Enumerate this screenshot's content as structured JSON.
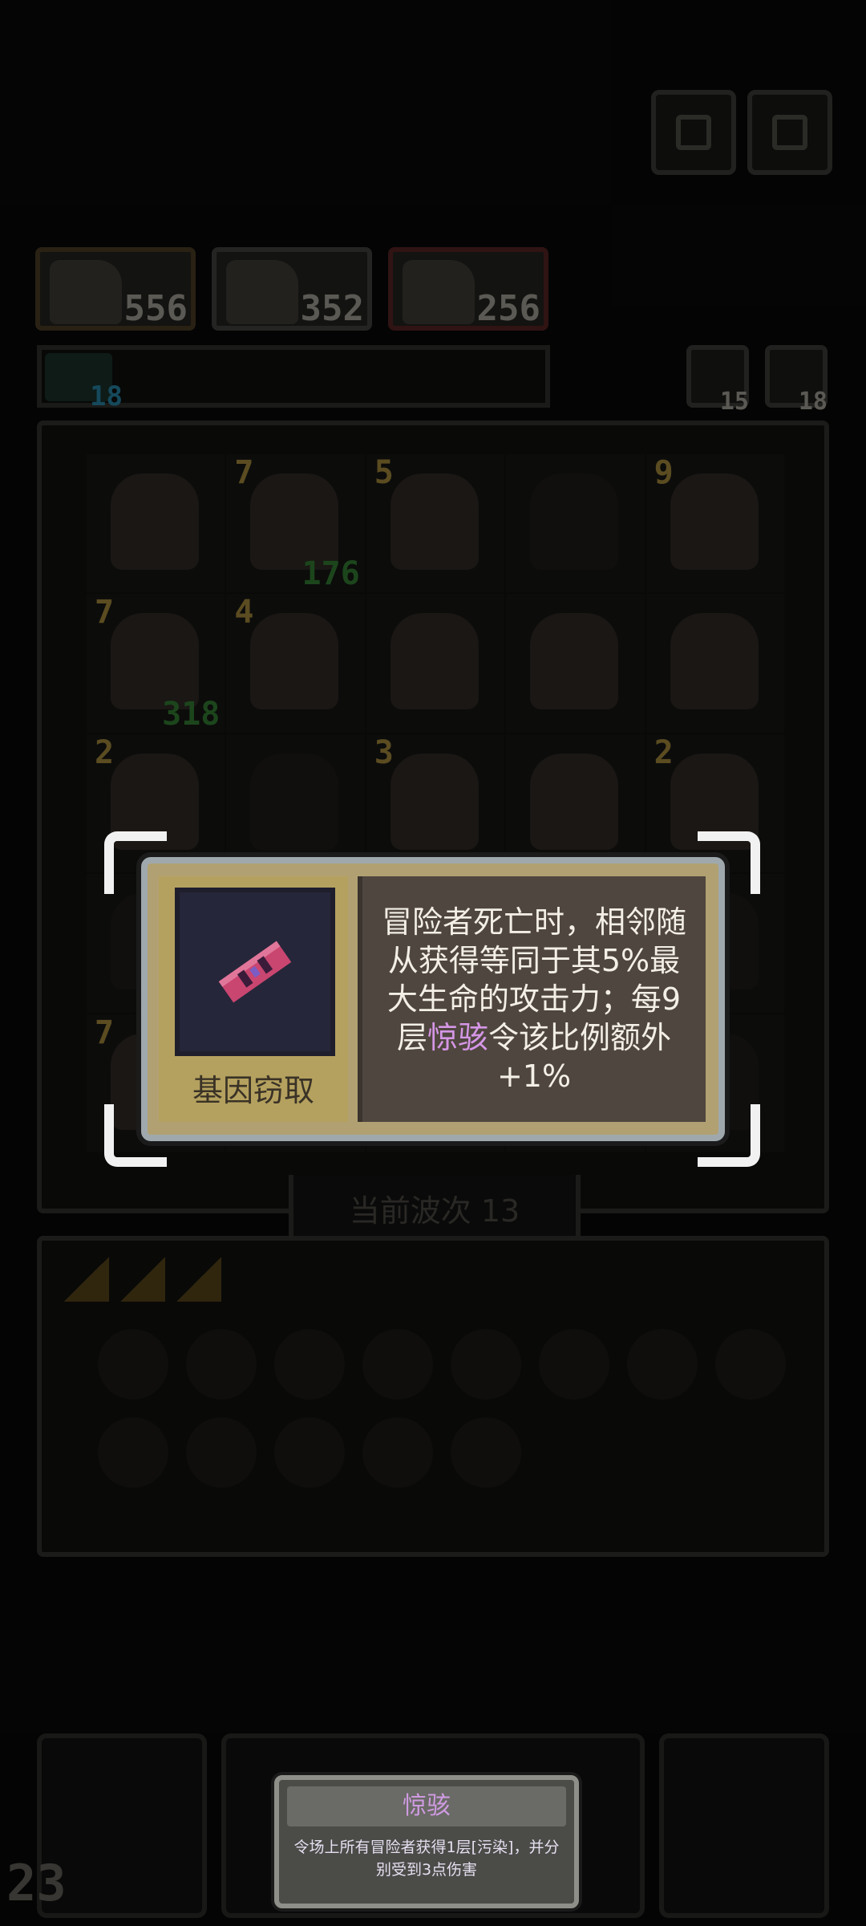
{
  "hud": {
    "heroes": [
      {
        "name": "hero-1",
        "hp": "556"
      },
      {
        "name": "hero-2",
        "hp": "352"
      },
      {
        "name": "hero-3",
        "hp": "256"
      }
    ],
    "resource_left": "18",
    "resource_right_1": "15",
    "resource_right_2": "18"
  },
  "board": {
    "cells": [
      {
        "lvl": "",
        "gold": ""
      },
      {
        "lvl": "7",
        "gold": "176"
      },
      {
        "lvl": "5",
        "gold": ""
      },
      {
        "lvl": "",
        "gold": ""
      },
      {
        "lvl": "9",
        "gold": ""
      },
      {
        "lvl": "7",
        "gold": "318"
      },
      {
        "lvl": "4",
        "gold": ""
      },
      {
        "lvl": "",
        "gold": ""
      },
      {
        "lvl": "",
        "gold": ""
      },
      {
        "lvl": "",
        "gold": ""
      },
      {
        "lvl": "2",
        "gold": ""
      },
      {
        "lvl": "",
        "gold": ""
      },
      {
        "lvl": "3",
        "gold": ""
      },
      {
        "lvl": "",
        "gold": ""
      },
      {
        "lvl": "2",
        "gold": ""
      },
      {
        "lvl": "",
        "gold": ""
      },
      {
        "lvl": "",
        "gold": ""
      },
      {
        "lvl": "",
        "gold": ""
      },
      {
        "lvl": "",
        "gold": ""
      },
      {
        "lvl": "",
        "gold": ""
      },
      {
        "lvl": "7",
        "gold": ""
      },
      {
        "lvl": "",
        "gold": ""
      },
      {
        "lvl": "",
        "gold": ""
      },
      {
        "lvl": "",
        "gold": ""
      },
      {
        "lvl": "",
        "gold": ""
      }
    ],
    "wave_label": "当前波次 13"
  },
  "tooltip": {
    "item_name": "基因窃取",
    "desc_part1": "冒险者死亡时，相邻随从获得等同于其5%最大生命的攻击力；每9层",
    "desc_highlight": "惊骇",
    "desc_part2": "令该比例额外+1%",
    "highlight_color": "#d596e6"
  },
  "bottom": {
    "level": "23"
  },
  "toast": {
    "title": "惊骇",
    "body": "令场上所有冒险者获得1层[污染]，并分别受到3点伤害"
  }
}
